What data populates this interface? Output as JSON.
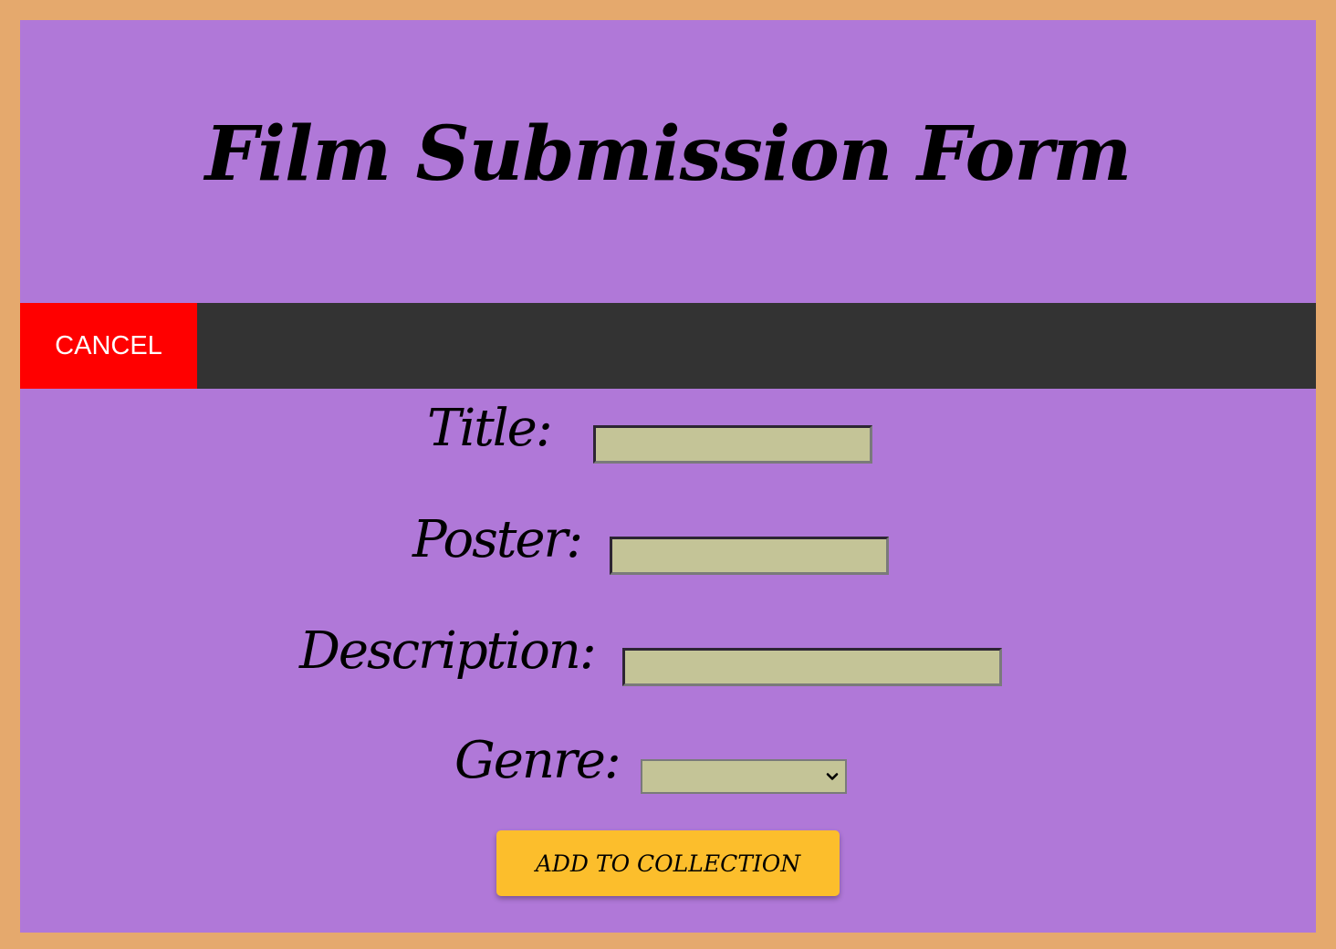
{
  "header": {
    "title": "Film Submission Form"
  },
  "nav": {
    "cancel_label": "CANCEL"
  },
  "form": {
    "title_label": "Title:",
    "title_value": "",
    "poster_label": "Poster:",
    "poster_value": "",
    "description_label": "Description:",
    "description_value": "",
    "genre_label": "Genre:",
    "genre_selected": "",
    "submit_label": "ADD TO COLLECTION"
  },
  "colors": {
    "page_border": "#e5a96d",
    "panel_background": "#b078d8",
    "navbar_background": "#333333",
    "cancel_background": "#ff0000",
    "input_background": "#c4c497",
    "submit_background": "#fcbe2c"
  },
  "icons": {
    "genre_dropdown": "chevron-down-icon"
  }
}
